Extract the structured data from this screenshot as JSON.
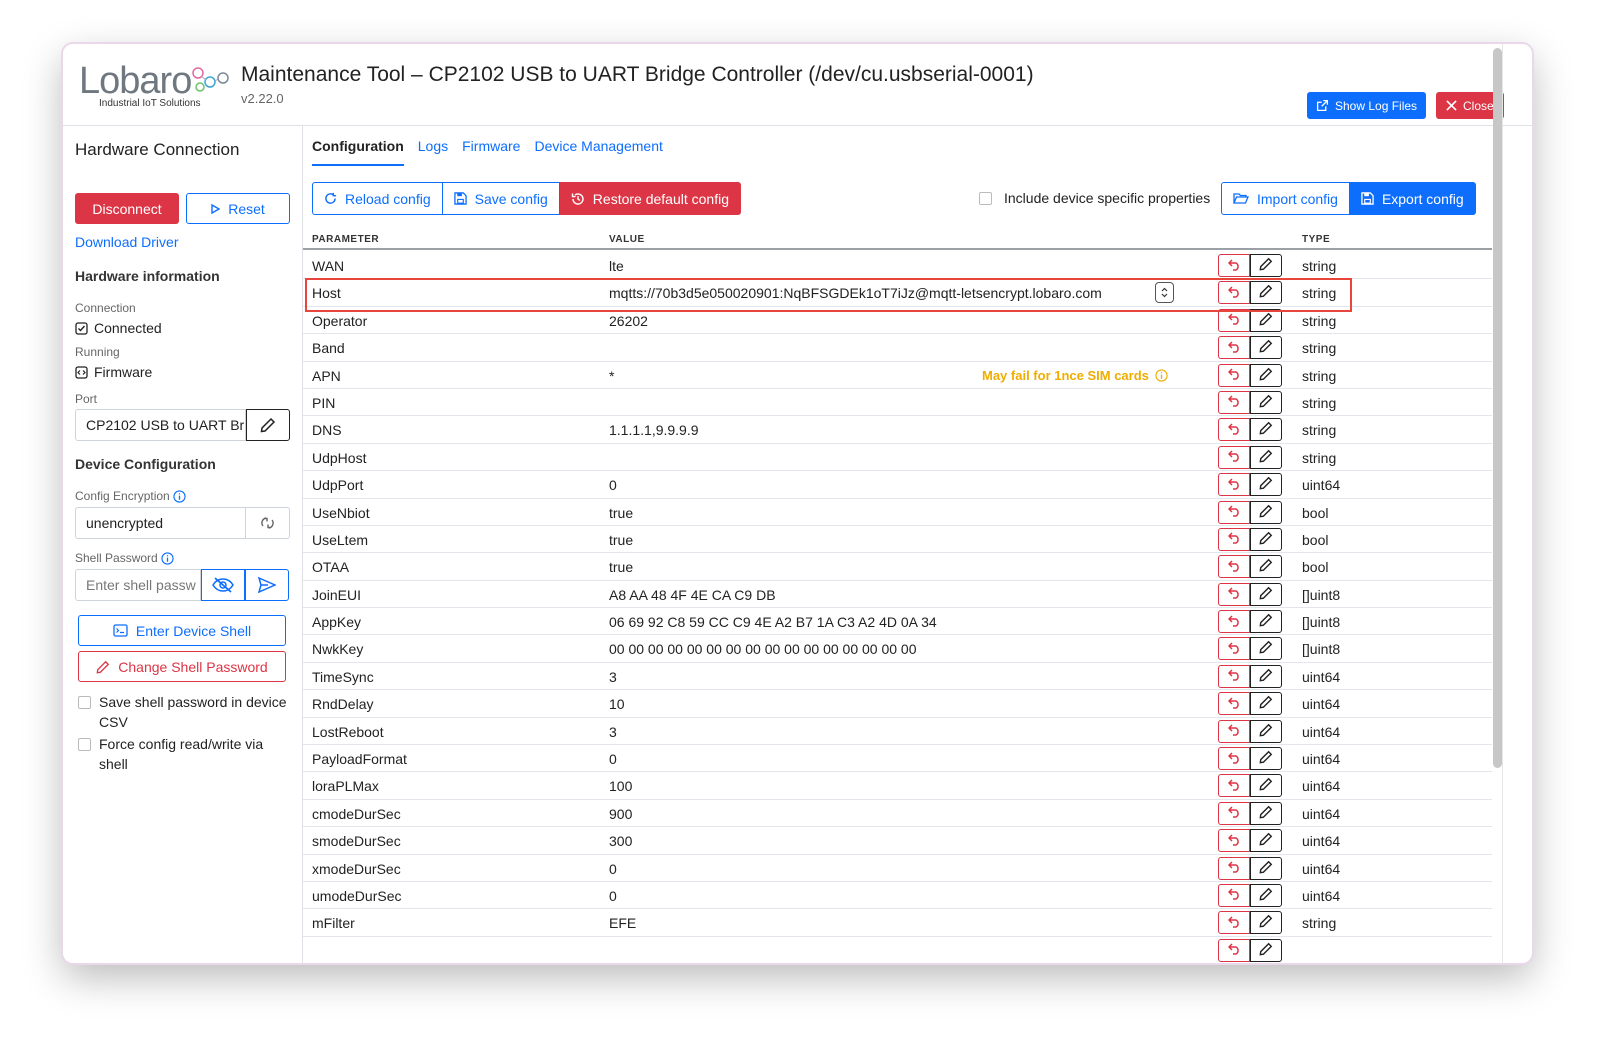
{
  "header": {
    "logo_text": "Lobaro",
    "logo_sub": "Industrial IoT Solutions",
    "title": "Maintenance Tool – CP2102 USB to UART Bridge Controller (/dev/cu.usbserial-0001)",
    "version": "v2.22.0",
    "show_log_label": "Show Log Files",
    "close_label": "Close"
  },
  "sidebar": {
    "heading": "Hardware Connection",
    "disconnect_label": "Disconnect",
    "reset_label": "Reset",
    "download_driver": "Download Driver",
    "hw_info_heading": "Hardware information",
    "connection_label": "Connection",
    "connection_value": "Connected",
    "running_label": "Running",
    "running_value": "Firmware",
    "port_label": "Port",
    "port_value": "CP2102 USB to UART Br",
    "device_config_heading": "Device Configuration",
    "config_encryption_label": "Config Encryption",
    "config_encryption_value": "unencrypted",
    "shell_password_label": "Shell Password",
    "shell_password_placeholder": "Enter shell passw",
    "enter_shell_label": "Enter Device Shell",
    "change_password_label": "Change Shell Password",
    "save_password_label": "Save shell password in device CSV",
    "force_config_label": "Force config read/write via shell"
  },
  "tabs": [
    "Configuration",
    "Logs",
    "Firmware",
    "Device Management"
  ],
  "toolbar": {
    "reload_label": "Reload config",
    "save_label": "Save config",
    "restore_label": "Restore default config",
    "include_label": "Include device specific properties",
    "import_label": "Import config",
    "export_label": "Export config"
  },
  "table": {
    "headers": {
      "parameter": "PARAMETER",
      "value": "VALUE",
      "type": "TYPE"
    },
    "rows": [
      {
        "name": "WAN",
        "value": "lte",
        "type": "string"
      },
      {
        "name": "Host",
        "value": "mqtts://70b3d5e050020901:NqBFSGDEk1oT7iJz@mqtt-letsencrypt.lobaro.com",
        "type": "string"
      },
      {
        "name": "Operator",
        "value": "26202",
        "type": "string"
      },
      {
        "name": "Band",
        "value": "",
        "type": "string"
      },
      {
        "name": "APN",
        "value": "*",
        "type": "string",
        "note": "May fail for 1nce SIM cards"
      },
      {
        "name": "PIN",
        "value": "",
        "type": "string"
      },
      {
        "name": "DNS",
        "value": "1.1.1.1,9.9.9.9",
        "type": "string"
      },
      {
        "name": "UdpHost",
        "value": "",
        "type": "string"
      },
      {
        "name": "UdpPort",
        "value": "0",
        "type": "uint64"
      },
      {
        "name": "UseNbiot",
        "value": "true",
        "type": "bool"
      },
      {
        "name": "UseLtem",
        "value": "true",
        "type": "bool"
      },
      {
        "name": "OTAA",
        "value": "true",
        "type": "bool"
      },
      {
        "name": "JoinEUI",
        "value": "A8 AA 48 4F 4E CA C9 DB",
        "type": "[]uint8"
      },
      {
        "name": "AppKey",
        "value": "06 69 92 C8 59 CC C9 4E A2 B7 1A C3 A2 4D 0A 34",
        "type": "[]uint8"
      },
      {
        "name": "NwkKey",
        "value": "00 00 00 00 00 00 00 00 00 00 00 00 00 00 00 00",
        "type": "[]uint8"
      },
      {
        "name": "TimeSync",
        "value": "3",
        "type": "uint64"
      },
      {
        "name": "RndDelay",
        "value": "10",
        "type": "uint64"
      },
      {
        "name": "LostReboot",
        "value": "3",
        "type": "uint64"
      },
      {
        "name": "PayloadFormat",
        "value": "0",
        "type": "uint64"
      },
      {
        "name": "loraPLMax",
        "value": "100",
        "type": "uint64"
      },
      {
        "name": "cmodeDurSec",
        "value": "900",
        "type": "uint64"
      },
      {
        "name": "smodeDurSec",
        "value": "300",
        "type": "uint64"
      },
      {
        "name": "xmodeDurSec",
        "value": "0",
        "type": "uint64"
      },
      {
        "name": "umodeDurSec",
        "value": "0",
        "type": "uint64"
      },
      {
        "name": "mFilter",
        "value": "EFE",
        "type": "string"
      },
      {
        "name": "",
        "value": "",
        "type": ""
      }
    ]
  },
  "colors": {
    "primary": "#0d6efd",
    "danger": "#dc3545",
    "warning": "#f0ad00",
    "highlight": "#e8453c"
  },
  "icons": {
    "undo": "undo-arrow-icon",
    "edit": "pencil-icon",
    "reload": "reload-icon",
    "save": "floppy-icon",
    "restore": "history-icon",
    "import": "folder-open-icon",
    "export": "floppy-icon"
  }
}
